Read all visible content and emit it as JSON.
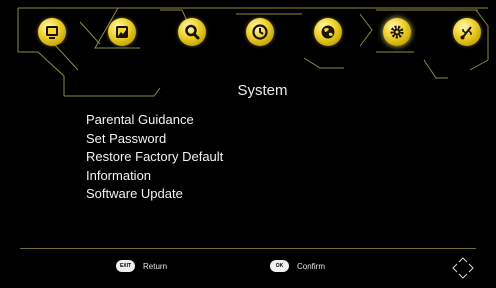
{
  "colors": {
    "accent": "#f4d83a",
    "line": "#8c8a3c",
    "background": "#000000"
  },
  "tabs": [
    {
      "name": "tv-icon"
    },
    {
      "name": "picture-icon"
    },
    {
      "name": "search-icon"
    },
    {
      "name": "clock-icon"
    },
    {
      "name": "globe-icon"
    },
    {
      "name": "gear-icon"
    },
    {
      "name": "usb-icon"
    }
  ],
  "active_tab": "gear-icon",
  "page": {
    "title": "System"
  },
  "menu": {
    "items": [
      {
        "label": "Parental Guidance"
      },
      {
        "label": "Set Password"
      },
      {
        "label": "Restore Factory Default"
      },
      {
        "label": "Information"
      },
      {
        "label": "Software Update"
      }
    ]
  },
  "footer": {
    "return_key": "EXIT",
    "return_label": "Return",
    "confirm_key": "OK",
    "confirm_label": "Confirm"
  }
}
